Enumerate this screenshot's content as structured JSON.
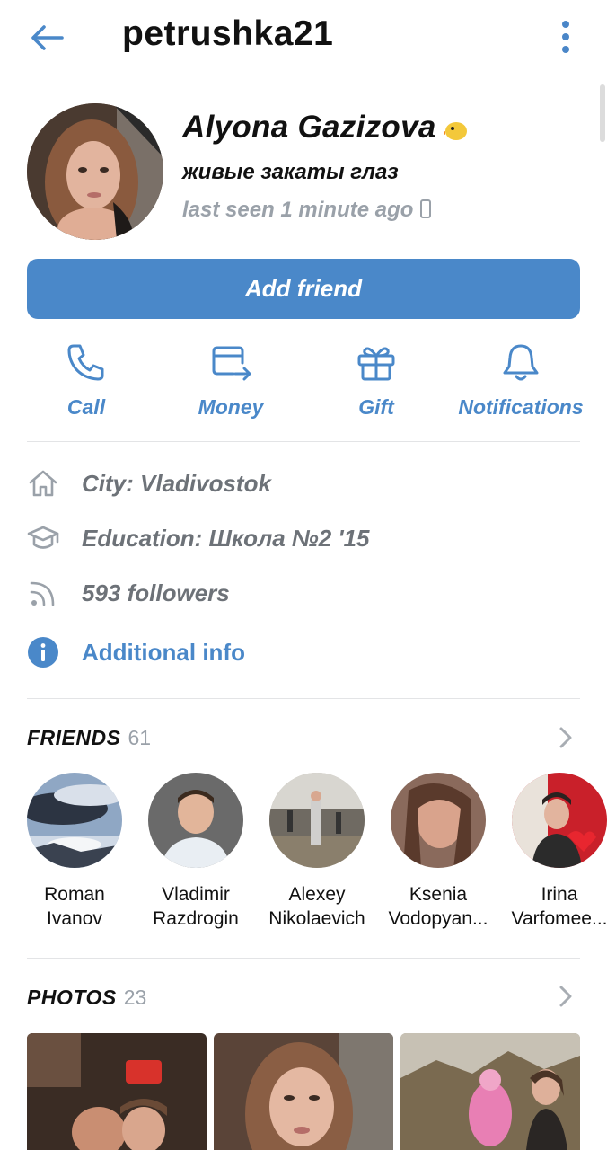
{
  "header": {
    "username": "petrushka21"
  },
  "profile": {
    "name": "Alyona Gazizova",
    "status": "живые закаты глаз",
    "last_seen": "last seen 1 minute ago"
  },
  "add_friend_label": "Add friend",
  "actions": [
    {
      "label": "Call",
      "icon": "phone-icon"
    },
    {
      "label": "Money",
      "icon": "card-transfer-icon"
    },
    {
      "label": "Gift",
      "icon": "gift-icon"
    },
    {
      "label": "Notifications",
      "icon": "bell-icon"
    }
  ],
  "info": {
    "city": "City: Vladivostok",
    "education": "Education: Школа №2 '15",
    "followers": "593 followers",
    "additional": "Additional info"
  },
  "friends": {
    "title": "FRIENDS",
    "count": "61",
    "items": [
      {
        "first": "Roman",
        "last": "Ivanov"
      },
      {
        "first": "Vladimir",
        "last": "Razdrogin"
      },
      {
        "first": "Alexey",
        "last": "Nikolaevich"
      },
      {
        "first": "Ksenia",
        "last": "Vodopyan..."
      },
      {
        "first": "Irina",
        "last": "Varfomee..."
      }
    ]
  },
  "photos": {
    "title": "PHOTOS",
    "count": "23"
  },
  "colors": {
    "accent": "#4a88c9",
    "muted": "#9aa1a9",
    "secondary_text": "#6d7278"
  }
}
